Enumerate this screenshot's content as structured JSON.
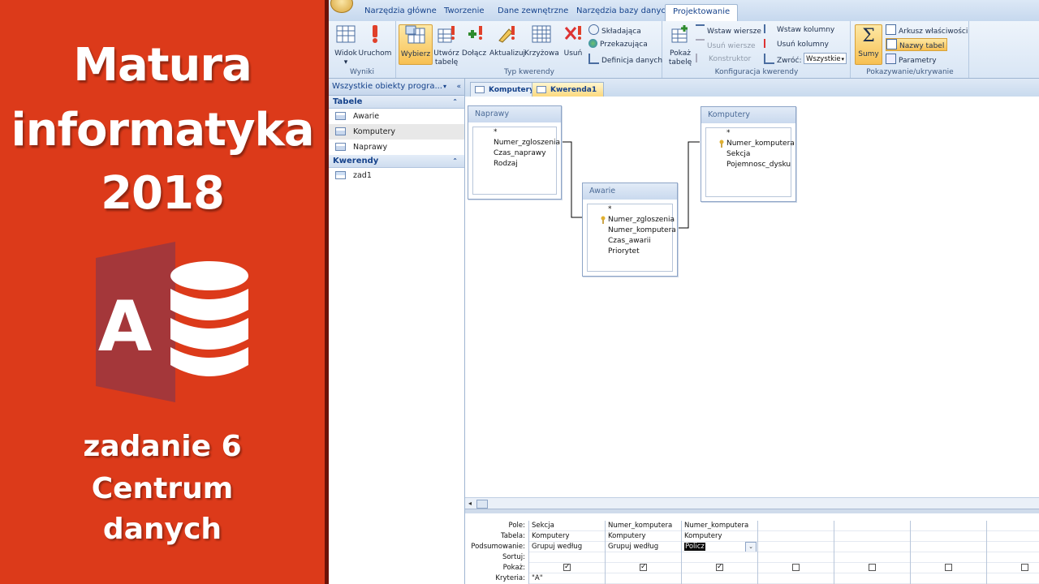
{
  "banner": {
    "title_lines": [
      "Matura",
      "informatyka",
      "2018"
    ],
    "subtitle_lines": [
      "zadanie 6",
      "Centrum",
      "danych"
    ],
    "logo_letter": "A",
    "colors": {
      "background": "#dc3a1a",
      "logo": "#a4373a"
    }
  },
  "ribbon": {
    "tabs": [
      "Narzędzia główne",
      "Tworzenie",
      "Dane zewnętrzne",
      "Narzędzia bazy danych",
      "Projektowanie"
    ],
    "active_tab": "Projektowanie",
    "groups": {
      "wyniki": {
        "label": "Wyniki",
        "buttons": [
          "Widok",
          "Uruchom"
        ]
      },
      "typ": {
        "label": "Typ kwerendy",
        "buttons": [
          "Wybierz",
          "Utwórz tabelę",
          "Dołącz",
          "Aktualizuj",
          "Krzyżowa",
          "Usuń"
        ],
        "small": [
          "Składająca",
          "Przekazująca",
          "Definicja danych"
        ]
      },
      "konfig": {
        "label": "Konfiguracja kwerendy",
        "big": "Pokaż tabelę",
        "small": [
          "Wstaw wiersze",
          "Usuń wiersze",
          "Konstruktor",
          "Wstaw kolumny",
          "Usuń kolumny",
          "Zwróć:"
        ],
        "return_value": "Wszystkie"
      },
      "pokaz": {
        "label": "Pokazywanie/ukrywanie",
        "big": "Sumy",
        "small": [
          "Arkusz właściwości",
          "Nazwy tabel",
          "Parametry"
        ]
      }
    }
  },
  "nav": {
    "header": "Wszystkie obiekty progra...",
    "sections": [
      {
        "title": "Tabele",
        "items": [
          "Awarie",
          "Komputery",
          "Naprawy"
        ]
      },
      {
        "title": "Kwerendy",
        "items": [
          "zad1"
        ]
      }
    ],
    "selected_item": "Komputery"
  },
  "doc_tabs": [
    "Komputery",
    "Kwerenda1"
  ],
  "active_doc_tab": "Kwerenda1",
  "tables": {
    "naprawy": {
      "title": "Naprawy",
      "fields": [
        "*",
        "Numer_zgloszenia",
        "Czas_naprawy",
        "Rodzaj"
      ]
    },
    "awarie": {
      "title": "Awarie",
      "fields": [
        "*",
        "Numer_zgloszenia",
        "Numer_komputera",
        "Czas_awarii",
        "Priorytet"
      ],
      "key": "Numer_zgloszenia"
    },
    "komputery": {
      "title": "Komputery",
      "fields": [
        "*",
        "Numer_komputera",
        "Sekcja",
        "Pojemnosc_dysku"
      ],
      "key": "Numer_komputera"
    }
  },
  "grid": {
    "row_labels": [
      "Pole:",
      "Tabela:",
      "Podsumowanie:",
      "Sortuj:",
      "Pokaż:",
      "Kryteria:"
    ],
    "columns": [
      {
        "pole": "Sekcja",
        "tabela": "Komputery",
        "podsumowanie": "Grupuj według",
        "pokaz": true,
        "kryteria": "\"A\""
      },
      {
        "pole": "Numer_komputera",
        "tabela": "Komputery",
        "podsumowanie": "Grupuj według",
        "pokaz": true,
        "kryteria": ""
      },
      {
        "pole": "Numer_komputera",
        "tabela": "Komputery",
        "podsumowanie": "Policz",
        "pokaz": true,
        "kryteria": ""
      },
      {
        "pole": "",
        "tabela": "",
        "podsumowanie": "",
        "pokaz": false,
        "kryteria": ""
      },
      {
        "pole": "",
        "tabela": "",
        "podsumowanie": "",
        "pokaz": false,
        "kryteria": ""
      },
      {
        "pole": "",
        "tabela": "",
        "podsumowanie": "",
        "pokaz": false,
        "kryteria": ""
      },
      {
        "pole": "",
        "tabela": "",
        "podsumowanie": "",
        "pokaz": false,
        "kryteria": ""
      }
    ]
  }
}
